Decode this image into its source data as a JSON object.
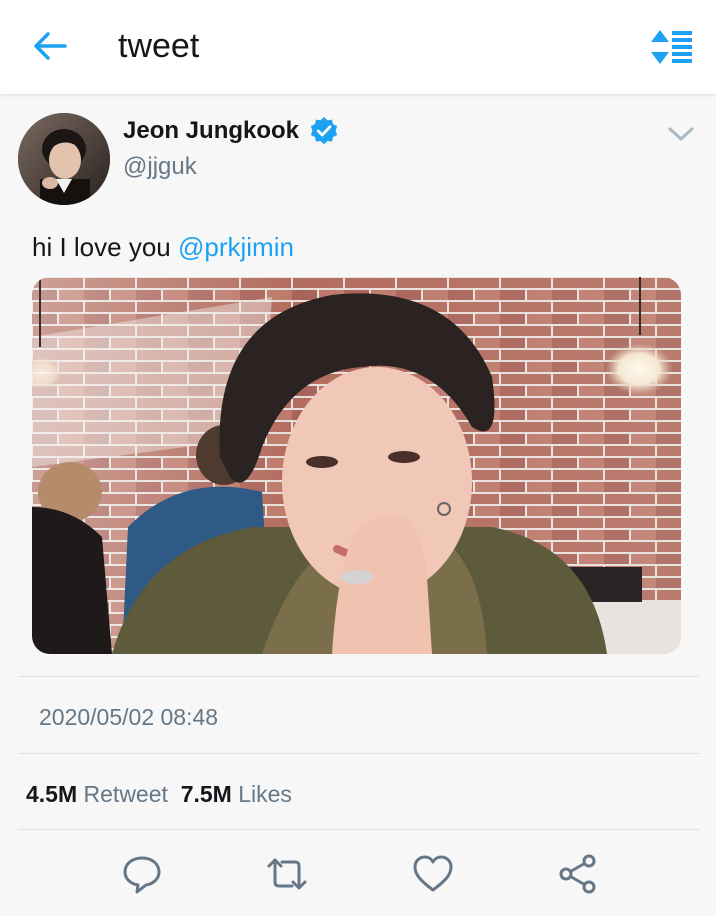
{
  "header": {
    "title": "tweet",
    "back_icon": "arrow-left-icon",
    "sort_icon": "sort-icon",
    "accent_color": "#1da1f2"
  },
  "tweet": {
    "author": {
      "display_name": "Jeon Jungkook",
      "handle": "@jjguk",
      "verified": true,
      "verified_icon": "verified-badge-icon"
    },
    "more_icon": "chevron-down-icon",
    "text": "hi I love you ",
    "mention": "@prkjimin",
    "timestamp": "2020/05/02 08:48",
    "stats": {
      "retweet_count": "4.5M",
      "retweet_label": "Retweet",
      "like_count": "7.5M",
      "like_label": "Likes"
    },
    "actions": [
      {
        "name": "reply",
        "icon": "reply-icon"
      },
      {
        "name": "retweet",
        "icon": "retweet-icon"
      },
      {
        "name": "like",
        "icon": "heart-icon"
      },
      {
        "name": "share",
        "icon": "share-icon"
      }
    ]
  }
}
